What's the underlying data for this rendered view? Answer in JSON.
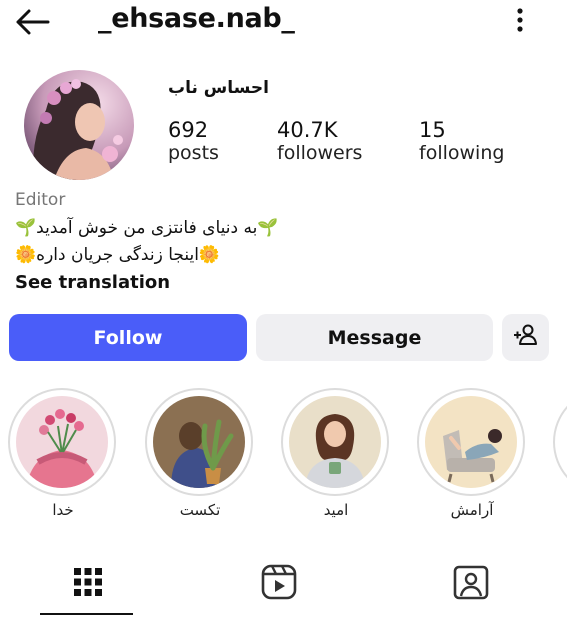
{
  "header": {
    "username": "_ehsase.nab_",
    "back_icon": "arrow-left-icon",
    "menu_icon": "more-vertical-icon"
  },
  "profile": {
    "display_name": "احساس ناب",
    "stats": [
      {
        "value": "692",
        "label": "posts"
      },
      {
        "value": "40.7K",
        "label": "followers"
      },
      {
        "value": "15",
        "label": "following"
      }
    ],
    "category": "Editor",
    "bio_lines": [
      "🌱به دنیای فانتزی من خوش آمدید🌱",
      "🌼اینجا زندگی جریان داره🌼"
    ],
    "see_translation": "See translation"
  },
  "actions": {
    "follow_label": "Follow",
    "message_label": "Message",
    "add_icon": "person-plus-icon"
  },
  "highlights": [
    {
      "label": "خدا"
    },
    {
      "label": "تکست"
    },
    {
      "label": "امید"
    },
    {
      "label": "آرامش"
    }
  ],
  "tabs": [
    {
      "icon": "grid-icon",
      "active": true
    },
    {
      "icon": "reels-icon",
      "active": false
    },
    {
      "icon": "tagged-icon",
      "active": false
    }
  ],
  "colors": {
    "follow_bg": "#4a5df9",
    "secondary_bg": "#efeff2"
  }
}
